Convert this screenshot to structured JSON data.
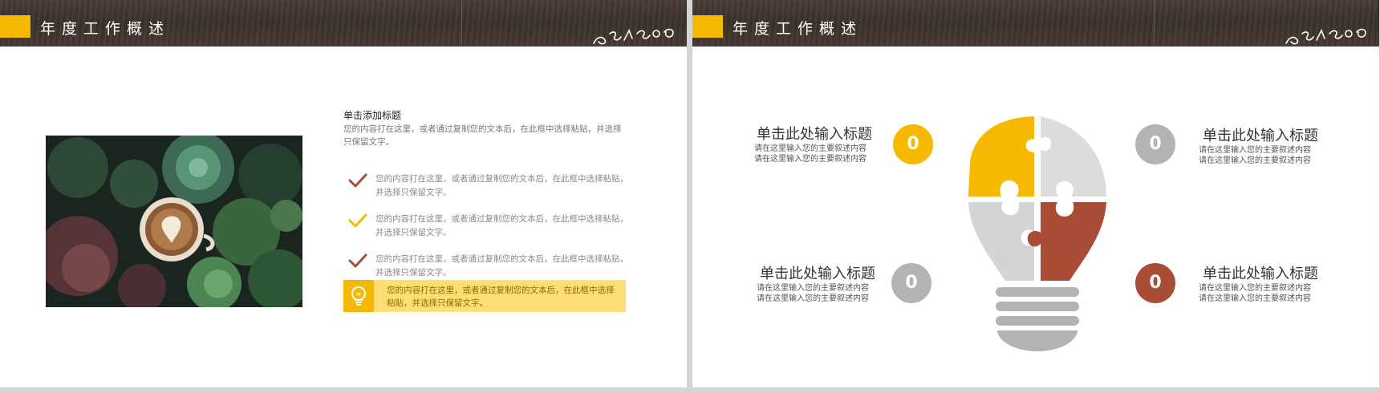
{
  "slide1": {
    "header_title": "年度工作概述",
    "title": "单击添加标题",
    "desc": "您的内容打在这里，或者通过复制您的文本后，在此框中选择粘贴，并选择只保留文字。",
    "items": [
      {
        "text": "您的内容打在这里，或者通过复制您的文本后，在此框中选择粘贴，并选择只保留文字。",
        "color": "#a84c35",
        "icon": "check-icon"
      },
      {
        "text": "您的内容打在这里，或者通过复制您的文本后，在此框中选择粘贴，并选择只保留文字。",
        "color": "#f6b900",
        "icon": "check-icon"
      },
      {
        "text": "您的内容打在这里，或者通过复制您的文本后，在此框中选择粘贴，并选择只保留文字。",
        "color": "#a84c35",
        "icon": "check-icon"
      }
    ],
    "highlight": {
      "text": "您的内容打在这里，或者通过复制您的文本后，在此框中选择粘贴，并选择只保留文字。",
      "icon": "lightbulb-icon"
    }
  },
  "slide2": {
    "header_title": "年度工作概述",
    "quadrants": [
      {
        "title": "单击此处输入标题",
        "line1": "请在这里输入您的主要叙述内容",
        "line2": "请在这里输入您的主要叙述内容",
        "number": "0",
        "color": "#f6b900"
      },
      {
        "title": "单击此处输入标题",
        "line1": "请在这里输入您的主要叙述内容",
        "line2": "请在这里输入您的主要叙述内容",
        "number": "0",
        "color": "#b3b3b3"
      },
      {
        "title": "单击此处输入标题",
        "line1": "请在这里输入您的主要叙述内容",
        "line2": "请在这里输入您的主要叙述内容",
        "number": "0",
        "color": "#b3b3b3"
      },
      {
        "title": "单击此处输入标题",
        "line1": "请在这里输入您的主要叙述内容",
        "line2": "请在这里输入您的主要叙述内容",
        "number": "0",
        "color": "#a84c35"
      }
    ]
  },
  "colors": {
    "accent": "#f6b900",
    "brick": "#a84c35",
    "gray": "#b3b3b3",
    "light_gray": "#d9d9d9",
    "header_brown": "#3f342d"
  }
}
